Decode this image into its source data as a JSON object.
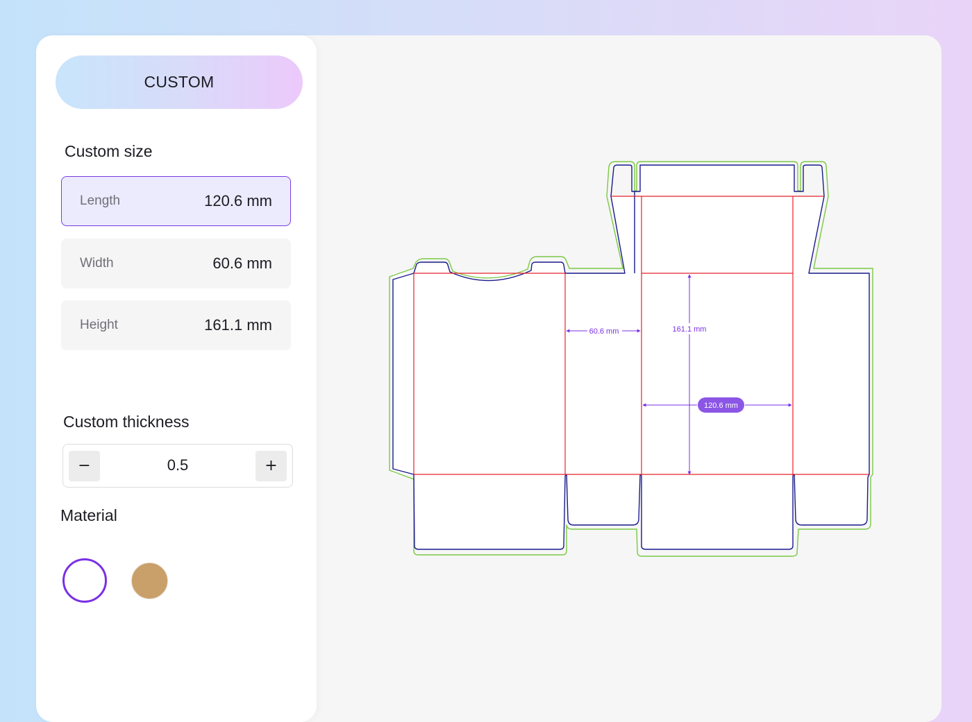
{
  "sidebar": {
    "mode_button": "CUSTOM",
    "custom_size_title": "Custom size",
    "dimensions": [
      {
        "label": "Length",
        "value": "120.6 mm",
        "active": true
      },
      {
        "label": "Width",
        "value": "60.6 mm",
        "active": false
      },
      {
        "label": "Height",
        "value": "161.1 mm",
        "active": false
      }
    ],
    "thickness_title": "Custom thickness",
    "thickness": {
      "decrement": "−",
      "value": "0.5",
      "increment": "+"
    },
    "material_title": "Material",
    "materials": [
      {
        "name": "white",
        "color": "#ffffff",
        "selected": true
      },
      {
        "name": "kraft",
        "color": "#c9a06a",
        "selected": false
      }
    ]
  },
  "dieline": {
    "width_label": "60.6 mm",
    "height_label": "161.1 mm",
    "length_label": "120.6 mm",
    "colors": {
      "bleed": "#7ac943",
      "cut": "#1a1a8c",
      "fold": "#e8202a",
      "dimension": "#7a2fe6"
    }
  }
}
